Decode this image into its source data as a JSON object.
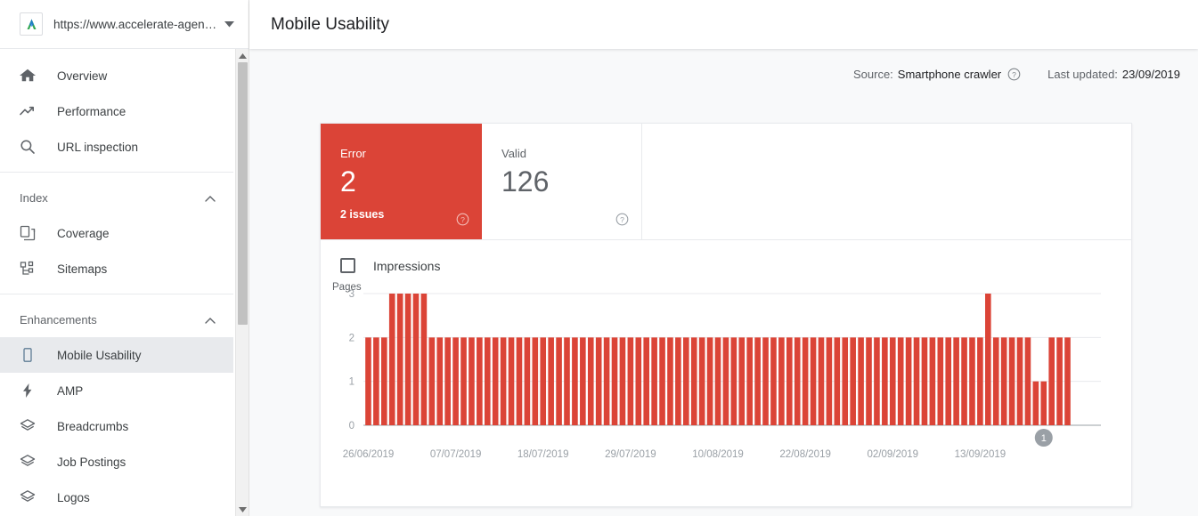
{
  "sidebar": {
    "property": {
      "url": "https://www.accelerate-agen…",
      "logo_icon": "site-logo-icon",
      "caret_icon": "chevron-down-icon"
    },
    "items": [
      {
        "label": "Overview",
        "icon": "home-icon",
        "selected": false
      },
      {
        "label": "Performance",
        "icon": "trending-up-icon",
        "selected": false
      },
      {
        "label": "URL inspection",
        "icon": "search-icon",
        "selected": false
      }
    ],
    "groups": [
      {
        "label": "Index",
        "collapse_icon": "chevron-up-icon",
        "items": [
          {
            "label": "Coverage",
            "icon": "pages-icon",
            "selected": false
          },
          {
            "label": "Sitemaps",
            "icon": "sitemap-icon",
            "selected": false
          }
        ]
      },
      {
        "label": "Enhancements",
        "collapse_icon": "chevron-up-icon",
        "items": [
          {
            "label": "Mobile Usability",
            "icon": "mobile-phone-icon",
            "selected": true
          },
          {
            "label": "AMP",
            "icon": "bolt-icon",
            "selected": false
          },
          {
            "label": "Breadcrumbs",
            "icon": "layers-icon",
            "selected": false
          },
          {
            "label": "Job Postings",
            "icon": "layers-icon",
            "selected": false
          },
          {
            "label": "Logos",
            "icon": "layers-icon",
            "selected": false
          }
        ]
      }
    ],
    "scrollbar": {
      "up_icon": "scroll-up-arrow-icon",
      "down_icon": "scroll-down-arrow-icon"
    }
  },
  "header": {
    "title": "Mobile Usability"
  },
  "meta": {
    "source_label": "Source:",
    "source_value": "Smartphone crawler",
    "source_help_icon": "help-circle-icon",
    "updated_label": "Last updated:",
    "updated_value": "23/09/2019"
  },
  "summary": {
    "error": {
      "name": "Error",
      "count": "2",
      "sub": "2 issues",
      "help_icon": "help-circle-icon",
      "color": "#DB4437"
    },
    "valid": {
      "name": "Valid",
      "count": "126",
      "help_icon": "help-circle-icon"
    }
  },
  "legend": {
    "impressions_label": "Impressions",
    "impressions_checked": false
  },
  "chart_data": {
    "type": "bar",
    "title": "",
    "ylabel": "Pages",
    "xlabel": "",
    "ylim": [
      0,
      3
    ],
    "yticks": [
      "0",
      "1",
      "2",
      "3"
    ],
    "grid": true,
    "legend_position": "top-left",
    "series": [
      {
        "name": "Pages",
        "color": "#DB4437",
        "values": [
          2,
          2,
          2,
          3,
          3,
          3,
          3,
          3,
          2,
          2,
          2,
          2,
          2,
          2,
          2,
          2,
          2,
          2,
          2,
          2,
          2,
          2,
          2,
          2,
          2,
          2,
          2,
          2,
          2,
          2,
          2,
          2,
          2,
          2,
          2,
          2,
          2,
          2,
          2,
          2,
          2,
          2,
          2,
          2,
          2,
          2,
          2,
          2,
          2,
          2,
          2,
          2,
          2,
          2,
          2,
          2,
          2,
          2,
          2,
          2,
          2,
          2,
          2,
          2,
          2,
          2,
          2,
          2,
          2,
          2,
          2,
          2,
          2,
          2,
          2,
          2,
          2,
          2,
          3,
          2,
          2,
          2,
          2,
          2,
          1,
          1,
          2,
          2,
          2
        ]
      }
    ],
    "xtick_labels": [
      "26/06/2019",
      "07/07/2019",
      "18/07/2019",
      "29/07/2019",
      "10/08/2019",
      "22/08/2019",
      "02/09/2019",
      "13/09/2019"
    ],
    "annotation_markers": [
      {
        "label": "1",
        "x_index": 85
      }
    ]
  }
}
